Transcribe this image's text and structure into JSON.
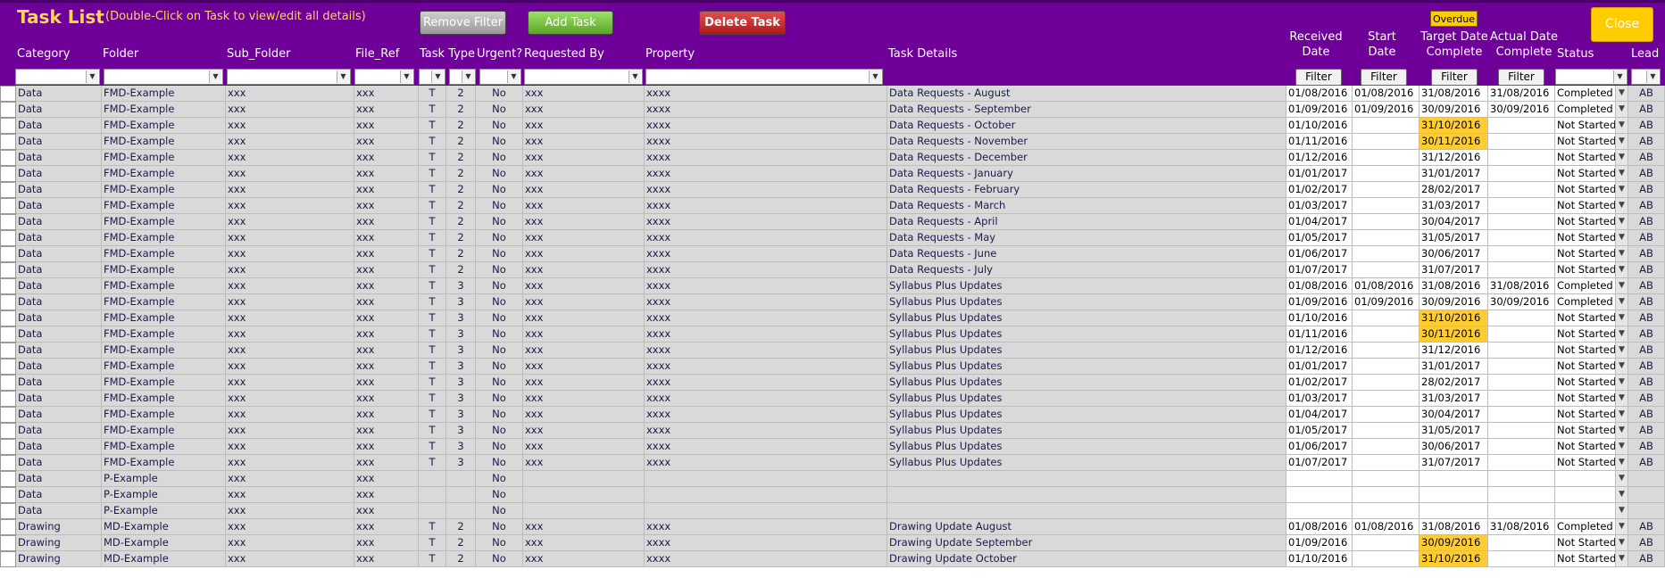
{
  "header": {
    "title": "Task List",
    "subtitle": "(Double-Click on Task to view/edit all details)",
    "remove_filter": "Remove Filter",
    "add_task": "Add Task",
    "delete_task": "Delete Task",
    "overdue": "Overdue",
    "close": "Close",
    "filter_label": "Filter"
  },
  "columns": [
    {
      "key": "category",
      "label": "Category"
    },
    {
      "key": "folder",
      "label": "Folder"
    },
    {
      "key": "sub_folder",
      "label": "Sub_Folder"
    },
    {
      "key": "file_ref",
      "label": "File_Ref"
    },
    {
      "key": "task_type",
      "label": "Task Type"
    },
    {
      "key": "urgent",
      "label": "Urgent?"
    },
    {
      "key": "requested_by",
      "label": "Requested By"
    },
    {
      "key": "property",
      "label": "Property"
    },
    {
      "key": "task_details",
      "label": "Task Details"
    },
    {
      "key": "received",
      "label": "Received\nDate"
    },
    {
      "key": "start",
      "label": "Start\nDate"
    },
    {
      "key": "target",
      "label": "Target Date\nComplete"
    },
    {
      "key": "actual",
      "label": "Actual Date\nComplete"
    },
    {
      "key": "status",
      "label": "Status"
    },
    {
      "key": "lead",
      "label": "Lead"
    }
  ],
  "colors": {
    "header_bg": "#6e0099",
    "title": "#ffd84d",
    "overdue": "#ffcc33",
    "row_bg": "#d9d9d9"
  },
  "rows": [
    {
      "cat": "Data",
      "folder": "FMD-Example",
      "sub": "xxx",
      "ref": "xxx",
      "type": "T",
      "pri": "2",
      "urgent": "No",
      "req": "xxx",
      "prop": "xxxx",
      "details": "Data Requests - August",
      "recv": "01/08/2016",
      "start": "01/08/2016",
      "target": "31/08/2016",
      "actual": "31/08/2016",
      "status": "Completed",
      "lead": "AB",
      "overdue": false
    },
    {
      "cat": "Data",
      "folder": "FMD-Example",
      "sub": "xxx",
      "ref": "xxx",
      "type": "T",
      "pri": "2",
      "urgent": "No",
      "req": "xxx",
      "prop": "xxxx",
      "details": "Data Requests - September",
      "recv": "01/09/2016",
      "start": "01/09/2016",
      "target": "30/09/2016",
      "actual": "30/09/2016",
      "status": "Completed",
      "lead": "AB",
      "overdue": false
    },
    {
      "cat": "Data",
      "folder": "FMD-Example",
      "sub": "xxx",
      "ref": "xxx",
      "type": "T",
      "pri": "2",
      "urgent": "No",
      "req": "xxx",
      "prop": "xxxx",
      "details": "Data Requests - October",
      "recv": "01/10/2016",
      "start": "",
      "target": "31/10/2016",
      "actual": "",
      "status": "Not Started",
      "lead": "AB",
      "overdue": true
    },
    {
      "cat": "Data",
      "folder": "FMD-Example",
      "sub": "xxx",
      "ref": "xxx",
      "type": "T",
      "pri": "2",
      "urgent": "No",
      "req": "xxx",
      "prop": "xxxx",
      "details": "Data Requests - November",
      "recv": "01/11/2016",
      "start": "",
      "target": "30/11/2016",
      "actual": "",
      "status": "Not Started",
      "lead": "AB",
      "overdue": true
    },
    {
      "cat": "Data",
      "folder": "FMD-Example",
      "sub": "xxx",
      "ref": "xxx",
      "type": "T",
      "pri": "2",
      "urgent": "No",
      "req": "xxx",
      "prop": "xxxx",
      "details": "Data Requests - December",
      "recv": "01/12/2016",
      "start": "",
      "target": "31/12/2016",
      "actual": "",
      "status": "Not Started",
      "lead": "AB",
      "overdue": false
    },
    {
      "cat": "Data",
      "folder": "FMD-Example",
      "sub": "xxx",
      "ref": "xxx",
      "type": "T",
      "pri": "2",
      "urgent": "No",
      "req": "xxx",
      "prop": "xxxx",
      "details": "Data Requests - January",
      "recv": "01/01/2017",
      "start": "",
      "target": "31/01/2017",
      "actual": "",
      "status": "Not Started",
      "lead": "AB",
      "overdue": false
    },
    {
      "cat": "Data",
      "folder": "FMD-Example",
      "sub": "xxx",
      "ref": "xxx",
      "type": "T",
      "pri": "2",
      "urgent": "No",
      "req": "xxx",
      "prop": "xxxx",
      "details": "Data Requests - February",
      "recv": "01/02/2017",
      "start": "",
      "target": "28/02/2017",
      "actual": "",
      "status": "Not Started",
      "lead": "AB",
      "overdue": false
    },
    {
      "cat": "Data",
      "folder": "FMD-Example",
      "sub": "xxx",
      "ref": "xxx",
      "type": "T",
      "pri": "2",
      "urgent": "No",
      "req": "xxx",
      "prop": "xxxx",
      "details": "Data Requests - March",
      "recv": "01/03/2017",
      "start": "",
      "target": "31/03/2017",
      "actual": "",
      "status": "Not Started",
      "lead": "AB",
      "overdue": false
    },
    {
      "cat": "Data",
      "folder": "FMD-Example",
      "sub": "xxx",
      "ref": "xxx",
      "type": "T",
      "pri": "2",
      "urgent": "No",
      "req": "xxx",
      "prop": "xxxx",
      "details": "Data Requests - April",
      "recv": "01/04/2017",
      "start": "",
      "target": "30/04/2017",
      "actual": "",
      "status": "Not Started",
      "lead": "AB",
      "overdue": false
    },
    {
      "cat": "Data",
      "folder": "FMD-Example",
      "sub": "xxx",
      "ref": "xxx",
      "type": "T",
      "pri": "2",
      "urgent": "No",
      "req": "xxx",
      "prop": "xxxx",
      "details": "Data Requests - May",
      "recv": "01/05/2017",
      "start": "",
      "target": "31/05/2017",
      "actual": "",
      "status": "Not Started",
      "lead": "AB",
      "overdue": false
    },
    {
      "cat": "Data",
      "folder": "FMD-Example",
      "sub": "xxx",
      "ref": "xxx",
      "type": "T",
      "pri": "2",
      "urgent": "No",
      "req": "xxx",
      "prop": "xxxx",
      "details": "Data Requests - June",
      "recv": "01/06/2017",
      "start": "",
      "target": "30/06/2017",
      "actual": "",
      "status": "Not Started",
      "lead": "AB",
      "overdue": false
    },
    {
      "cat": "Data",
      "folder": "FMD-Example",
      "sub": "xxx",
      "ref": "xxx",
      "type": "T",
      "pri": "2",
      "urgent": "No",
      "req": "xxx",
      "prop": "xxxx",
      "details": "Data Requests - July",
      "recv": "01/07/2017",
      "start": "",
      "target": "31/07/2017",
      "actual": "",
      "status": "Not Started",
      "lead": "AB",
      "overdue": false
    },
    {
      "cat": "Data",
      "folder": "FMD-Example",
      "sub": "xxx",
      "ref": "xxx",
      "type": "T",
      "pri": "3",
      "urgent": "No",
      "req": "xxx",
      "prop": "xxxx",
      "details": "Syllabus Plus Updates",
      "recv": "01/08/2016",
      "start": "01/08/2016",
      "target": "31/08/2016",
      "actual": "31/08/2016",
      "status": "Completed",
      "lead": "AB",
      "overdue": false
    },
    {
      "cat": "Data",
      "folder": "FMD-Example",
      "sub": "xxx",
      "ref": "xxx",
      "type": "T",
      "pri": "3",
      "urgent": "No",
      "req": "xxx",
      "prop": "xxxx",
      "details": "Syllabus Plus Updates",
      "recv": "01/09/2016",
      "start": "01/09/2016",
      "target": "30/09/2016",
      "actual": "30/09/2016",
      "status": "Completed",
      "lead": "AB",
      "overdue": false
    },
    {
      "cat": "Data",
      "folder": "FMD-Example",
      "sub": "xxx",
      "ref": "xxx",
      "type": "T",
      "pri": "3",
      "urgent": "No",
      "req": "xxx",
      "prop": "xxxx",
      "details": "Syllabus Plus Updates",
      "recv": "01/10/2016",
      "start": "",
      "target": "31/10/2016",
      "actual": "",
      "status": "Not Started",
      "lead": "AB",
      "overdue": true
    },
    {
      "cat": "Data",
      "folder": "FMD-Example",
      "sub": "xxx",
      "ref": "xxx",
      "type": "T",
      "pri": "3",
      "urgent": "No",
      "req": "xxx",
      "prop": "xxxx",
      "details": "Syllabus Plus Updates",
      "recv": "01/11/2016",
      "start": "",
      "target": "30/11/2016",
      "actual": "",
      "status": "Not Started",
      "lead": "AB",
      "overdue": true
    },
    {
      "cat": "Data",
      "folder": "FMD-Example",
      "sub": "xxx",
      "ref": "xxx",
      "type": "T",
      "pri": "3",
      "urgent": "No",
      "req": "xxx",
      "prop": "xxxx",
      "details": "Syllabus Plus Updates",
      "recv": "01/12/2016",
      "start": "",
      "target": "31/12/2016",
      "actual": "",
      "status": "Not Started",
      "lead": "AB",
      "overdue": false
    },
    {
      "cat": "Data",
      "folder": "FMD-Example",
      "sub": "xxx",
      "ref": "xxx",
      "type": "T",
      "pri": "3",
      "urgent": "No",
      "req": "xxx",
      "prop": "xxxx",
      "details": "Syllabus Plus Updates",
      "recv": "01/01/2017",
      "start": "",
      "target": "31/01/2017",
      "actual": "",
      "status": "Not Started",
      "lead": "AB",
      "overdue": false
    },
    {
      "cat": "Data",
      "folder": "FMD-Example",
      "sub": "xxx",
      "ref": "xxx",
      "type": "T",
      "pri": "3",
      "urgent": "No",
      "req": "xxx",
      "prop": "xxxx",
      "details": "Syllabus Plus Updates",
      "recv": "01/02/2017",
      "start": "",
      "target": "28/02/2017",
      "actual": "",
      "status": "Not Started",
      "lead": "AB",
      "overdue": false
    },
    {
      "cat": "Data",
      "folder": "FMD-Example",
      "sub": "xxx",
      "ref": "xxx",
      "type": "T",
      "pri": "3",
      "urgent": "No",
      "req": "xxx",
      "prop": "xxxx",
      "details": "Syllabus Plus Updates",
      "recv": "01/03/2017",
      "start": "",
      "target": "31/03/2017",
      "actual": "",
      "status": "Not Started",
      "lead": "AB",
      "overdue": false
    },
    {
      "cat": "Data",
      "folder": "FMD-Example",
      "sub": "xxx",
      "ref": "xxx",
      "type": "T",
      "pri": "3",
      "urgent": "No",
      "req": "xxx",
      "prop": "xxxx",
      "details": "Syllabus Plus Updates",
      "recv": "01/04/2017",
      "start": "",
      "target": "30/04/2017",
      "actual": "",
      "status": "Not Started",
      "lead": "AB",
      "overdue": false
    },
    {
      "cat": "Data",
      "folder": "FMD-Example",
      "sub": "xxx",
      "ref": "xxx",
      "type": "T",
      "pri": "3",
      "urgent": "No",
      "req": "xxx",
      "prop": "xxxx",
      "details": "Syllabus Plus Updates",
      "recv": "01/05/2017",
      "start": "",
      "target": "31/05/2017",
      "actual": "",
      "status": "Not Started",
      "lead": "AB",
      "overdue": false
    },
    {
      "cat": "Data",
      "folder": "FMD-Example",
      "sub": "xxx",
      "ref": "xxx",
      "type": "T",
      "pri": "3",
      "urgent": "No",
      "req": "xxx",
      "prop": "xxxx",
      "details": "Syllabus Plus Updates",
      "recv": "01/06/2017",
      "start": "",
      "target": "30/06/2017",
      "actual": "",
      "status": "Not Started",
      "lead": "AB",
      "overdue": false
    },
    {
      "cat": "Data",
      "folder": "FMD-Example",
      "sub": "xxx",
      "ref": "xxx",
      "type": "T",
      "pri": "3",
      "urgent": "No",
      "req": "xxx",
      "prop": "xxxx",
      "details": "Syllabus Plus Updates",
      "recv": "01/07/2017",
      "start": "",
      "target": "31/07/2017",
      "actual": "",
      "status": "Not Started",
      "lead": "AB",
      "overdue": false
    },
    {
      "cat": "Data",
      "folder": "P-Example",
      "sub": "xxx",
      "ref": "xxx",
      "type": "",
      "pri": "",
      "urgent": "No",
      "req": "",
      "prop": "",
      "details": "",
      "recv": "",
      "start": "",
      "target": "",
      "actual": "",
      "status": "",
      "lead": "",
      "overdue": false
    },
    {
      "cat": "Data",
      "folder": "P-Example",
      "sub": "xxx",
      "ref": "xxx",
      "type": "",
      "pri": "",
      "urgent": "No",
      "req": "",
      "prop": "",
      "details": "",
      "recv": "",
      "start": "",
      "target": "",
      "actual": "",
      "status": "",
      "lead": "",
      "overdue": false
    },
    {
      "cat": "Data",
      "folder": "P-Example",
      "sub": "xxx",
      "ref": "xxx",
      "type": "",
      "pri": "",
      "urgent": "No",
      "req": "",
      "prop": "",
      "details": "",
      "recv": "",
      "start": "",
      "target": "",
      "actual": "",
      "status": "",
      "lead": "",
      "overdue": false
    },
    {
      "cat": "Drawing",
      "folder": "MD-Example",
      "sub": "xxx",
      "ref": "xxx",
      "type": "T",
      "pri": "2",
      "urgent": "No",
      "req": "xxx",
      "prop": "xxxx",
      "details": "Drawing Update August",
      "recv": "01/08/2016",
      "start": "01/08/2016",
      "target": "31/08/2016",
      "actual": "31/08/2016",
      "status": "Completed",
      "lead": "AB",
      "overdue": false
    },
    {
      "cat": "Drawing",
      "folder": "MD-Example",
      "sub": "xxx",
      "ref": "xxx",
      "type": "T",
      "pri": "2",
      "urgent": "No",
      "req": "xxx",
      "prop": "xxxx",
      "details": "Drawing Update September",
      "recv": "01/09/2016",
      "start": "",
      "target": "30/09/2016",
      "actual": "",
      "status": "Not Started",
      "lead": "AB",
      "overdue": true
    },
    {
      "cat": "Drawing",
      "folder": "MD-Example",
      "sub": "xxx",
      "ref": "xxx",
      "type": "T",
      "pri": "2",
      "urgent": "No",
      "req": "xxx",
      "prop": "xxxx",
      "details": "Drawing Update October",
      "recv": "01/10/2016",
      "start": "",
      "target": "31/10/2016",
      "actual": "",
      "status": "Not Started",
      "lead": "AB",
      "overdue": true
    }
  ]
}
